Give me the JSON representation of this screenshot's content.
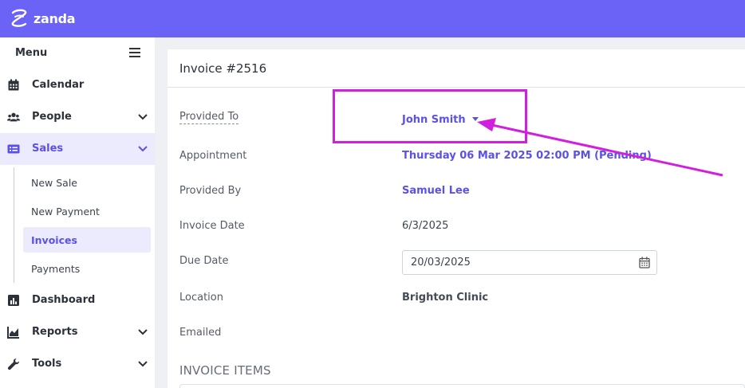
{
  "brand": {
    "name": "zanda",
    "color": "#6a63f5"
  },
  "sidebar": {
    "title": "Menu",
    "items": [
      {
        "label": "Calendar",
        "icon": "calendar-icon"
      },
      {
        "label": "People",
        "icon": "people-icon",
        "expandable": true
      },
      {
        "label": "Sales",
        "icon": "sales-icon",
        "expandable": true,
        "expanded": true,
        "active": true
      },
      {
        "label": "Dashboard",
        "icon": "dashboard-icon"
      },
      {
        "label": "Reports",
        "icon": "reports-icon",
        "expandable": true
      },
      {
        "label": "Tools",
        "icon": "wrench-icon",
        "expandable": true
      }
    ],
    "sales_subitems": [
      {
        "label": "New Sale"
      },
      {
        "label": "New Payment"
      },
      {
        "label": "Invoices",
        "active": true
      },
      {
        "label": "Payments"
      }
    ]
  },
  "invoice": {
    "title": "Invoice #2516",
    "fields": {
      "provided_to": {
        "label": "Provided To",
        "value": "John Smith"
      },
      "appointment": {
        "label": "Appointment",
        "value": "Thursday 06 Mar 2025 02:00 PM (Pending)"
      },
      "provided_by": {
        "label": "Provided By",
        "value": "Samuel Lee"
      },
      "invoice_date": {
        "label": "Invoice Date",
        "value": "6/3/2025"
      },
      "due_date": {
        "label": "Due Date",
        "value": "20/03/2025"
      },
      "location": {
        "label": "Location",
        "value": "Brighton Clinic"
      },
      "emailed": {
        "label": "Emailed",
        "value": ""
      }
    },
    "items_heading": "INVOICE ITEMS"
  },
  "annotation": {
    "color": "#d21fdf"
  }
}
